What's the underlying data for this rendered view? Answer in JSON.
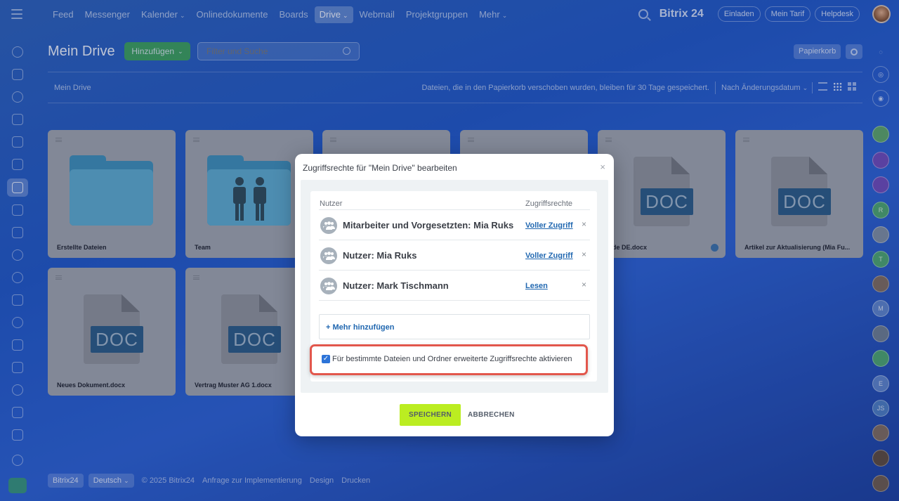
{
  "topnav": {
    "items": [
      {
        "label": "Feed",
        "active": false,
        "caret": false
      },
      {
        "label": "Messenger",
        "active": false,
        "caret": false
      },
      {
        "label": "Kalender",
        "active": false,
        "caret": true
      },
      {
        "label": "Onlinedokumente",
        "active": false,
        "caret": false
      },
      {
        "label": "Boards",
        "active": false,
        "caret": false
      },
      {
        "label": "Drive",
        "active": true,
        "caret": true
      },
      {
        "label": "Webmail",
        "active": false,
        "caret": false
      },
      {
        "label": "Projektgruppen",
        "active": false,
        "caret": false
      },
      {
        "label": "Mehr",
        "active": false,
        "caret": true
      }
    ],
    "brand": "Bitrix 24",
    "invite": "Einladen",
    "plan": "Mein Tarif",
    "help": "Helpdesk"
  },
  "page": {
    "title": "Mein Drive",
    "add_label": "Hinzufügen",
    "filter_placeholder": "Filter und Suche",
    "trash": "Papierkorb",
    "breadcrumb": "Mein Drive",
    "info": "Dateien, die in den Papierkorb verschoben wurden, bleiben für 30 Tage gespeichert.",
    "sort": "Nach Änderungsdatum"
  },
  "cards": [
    {
      "name": "Erstellte Dateien",
      "kind": "folder"
    },
    {
      "name": "Team",
      "kind": "shared-folder"
    },
    {
      "name": "",
      "kind": "hidden"
    },
    {
      "name": "",
      "kind": "hidden"
    },
    {
      "name": "uide DE.docx",
      "kind": "doc",
      "doc_label": "DOC"
    },
    {
      "name": "Artikel zur Aktualisierung (Mia Fu...",
      "kind": "doc",
      "doc_label": "DOC"
    },
    {
      "name": "Neues Dokument.docx",
      "kind": "doc",
      "doc_label": "DOC"
    },
    {
      "name": "Vertrag Muster AG 1.docx",
      "kind": "doc",
      "doc_label": "DOC"
    }
  ],
  "footer": {
    "brand": "Bitrix24",
    "language": "Deutsch",
    "copyright": "© 2025 Bitrix24",
    "implementation": "Anfrage zur Implementierung",
    "design": "Design",
    "print": "Drucken"
  },
  "modal": {
    "title": "Zugriffsrechte für \"Mein Drive\" bearbeiten",
    "col_user": "Nutzer",
    "col_rights": "Zugriffsrechte",
    "rows": [
      {
        "name": "Mitarbeiter und Vorgesetzten: Mia Ruks",
        "right": "Voller Zugriff"
      },
      {
        "name": "Nutzer: Mia Ruks",
        "right": "Voller Zugriff"
      },
      {
        "name": "Nutzer: Mark Tischmann",
        "right": "Lesen"
      }
    ],
    "add_more": "+ Mehr hinzufügen",
    "checkbox_label": "Für bestimmte Dateien und Ordner erweiterte Zugriffsrechte aktivieren",
    "checkbox_checked": true,
    "save": "SPEICHERN",
    "cancel": "ABBRECHEN"
  },
  "right_bar": [
    "R",
    "T",
    "M",
    "E",
    "JS"
  ],
  "colors": {
    "accent_green": "#bbed21",
    "link_blue": "#2067b0",
    "highlight_red": "#e2574c"
  }
}
